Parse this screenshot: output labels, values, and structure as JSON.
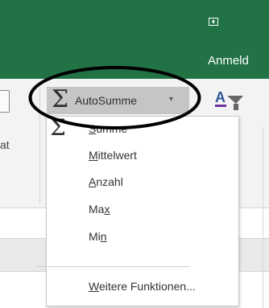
{
  "titlebar": {
    "signin_label": "Anmeld",
    "icon": "upload-icon",
    "background": "#217346"
  },
  "ribbon": {
    "fragment_label": "at",
    "autosum": {
      "icon": "sigma-icon",
      "label": "AutoSumme",
      "caret": "▾"
    },
    "sort_icon": "sort-filter-icon"
  },
  "menu": {
    "items": [
      {
        "id": "sum",
        "icon": "sigma-icon",
        "label_pre": "",
        "label_ul": "S",
        "label_post": "umme"
      },
      {
        "id": "average",
        "label_pre": "",
        "label_ul": "M",
        "label_post": "ittelwert"
      },
      {
        "id": "count",
        "label_pre": "",
        "label_ul": "A",
        "label_post": "nzahl"
      },
      {
        "id": "max",
        "label_pre": "Ma",
        "label_ul": "x",
        "label_post": ""
      },
      {
        "id": "min",
        "label_pre": "Mi",
        "label_ul": "n",
        "label_post": ""
      },
      {
        "id": "more",
        "label_pre": "",
        "label_ul": "W",
        "label_post": "eitere Funktionen..."
      }
    ]
  },
  "annotation": {
    "shape": "ellipse",
    "color": "#000000"
  }
}
